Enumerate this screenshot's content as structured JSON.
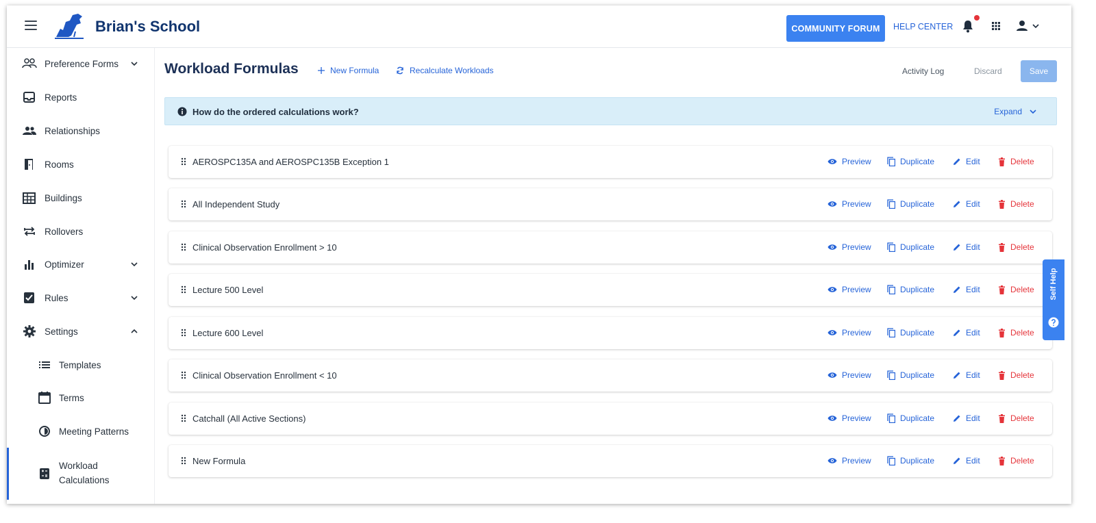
{
  "header": {
    "brand": "Brian's School",
    "community_forum": "COMMUNITY FORUM",
    "help_center": "HELP CENTER"
  },
  "sidebar": {
    "items": [
      {
        "label": "Preference Forms",
        "icon": "people-outline-icon",
        "chevron": "down"
      },
      {
        "label": "Reports",
        "icon": "inbox-icon"
      },
      {
        "label": "Relationships",
        "icon": "people-icon"
      },
      {
        "label": "Rooms",
        "icon": "door-icon"
      },
      {
        "label": "Buildings",
        "icon": "building-icon"
      },
      {
        "label": "Rollovers",
        "icon": "swap-arrows-icon"
      },
      {
        "label": "Optimizer",
        "icon": "bar-chart-icon",
        "chevron": "down"
      },
      {
        "label": "Rules",
        "icon": "checkbox-icon",
        "chevron": "down"
      },
      {
        "label": "Settings",
        "icon": "gear-icon",
        "chevron": "up"
      }
    ],
    "sub_items": [
      {
        "label": "Templates",
        "icon": "list-icon"
      },
      {
        "label": "Terms",
        "icon": "calendar-icon"
      },
      {
        "label": "Meeting Patterns",
        "icon": "clock-circle-icon"
      },
      {
        "label_line1": "Workload",
        "label_line2": "Calculations",
        "icon": "calculator-icon",
        "active": true
      }
    ]
  },
  "main": {
    "title": "Workload Formulas",
    "new_formula": "New Formula",
    "recalculate": "Recalculate Workloads",
    "activity_log": "Activity Log",
    "discard": "Discard",
    "save": "Save",
    "banner": {
      "text": "How do the ordered calculations work?",
      "expand": "Expand"
    },
    "row_actions": {
      "preview": "Preview",
      "duplicate": "Duplicate",
      "edit": "Edit",
      "delete": "Delete"
    },
    "formulas": [
      {
        "name": "AEROSPC135A and AEROSPC135B Exception 1"
      },
      {
        "name": "All Independent Study"
      },
      {
        "name": "Clinical Observation Enrollment > 10"
      },
      {
        "name": "Lecture 500 Level"
      },
      {
        "name": "Lecture 600 Level"
      },
      {
        "name": "Clinical Observation Enrollment < 10"
      },
      {
        "name": "Catchall (All Active Sections)"
      },
      {
        "name": "New Formula"
      }
    ]
  },
  "self_help": "Self Help",
  "colors": {
    "accent": "#3b82f0",
    "link": "#2563d8",
    "danger": "#e5343a",
    "banner": "#d9eef9",
    "brand": "#10346e"
  }
}
